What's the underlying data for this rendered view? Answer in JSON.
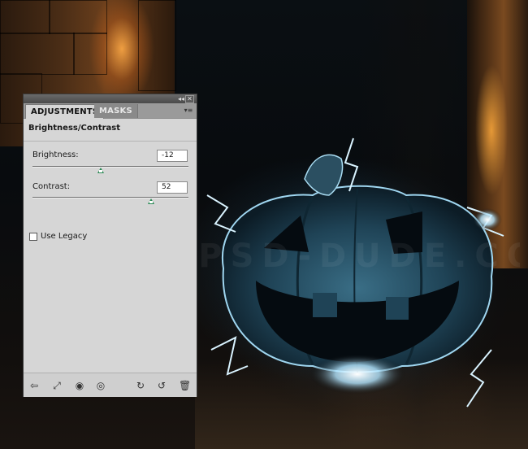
{
  "panel": {
    "tabs": [
      {
        "label": "ADJUSTMENTS",
        "active": true
      },
      {
        "label": "MASKS",
        "active": false
      }
    ],
    "collapse_glyph": "◂◂",
    "close_glyph": "✕",
    "menu_glyph": "▾≡",
    "heading": "Brightness/Contrast",
    "brightness": {
      "label": "Brightness:",
      "value": "-12",
      "slider_fraction": 0.44
    },
    "contrast": {
      "label": "Contrast:",
      "value": "52",
      "slider_fraction": 0.76
    },
    "use_legacy": {
      "label": "Use Legacy",
      "checked": false
    },
    "toolbar_icons": [
      {
        "name": "return-arrow-icon",
        "glyph": "⇦"
      },
      {
        "name": "expand-view-icon",
        "glyph": "⤢"
      },
      {
        "name": "clip-layer-icon",
        "glyph": "◉"
      },
      {
        "name": "visibility-eye-icon",
        "glyph": "◎"
      },
      {
        "name": "view-previous-icon",
        "glyph": "↻"
      },
      {
        "name": "reset-icon",
        "glyph": "↺"
      },
      {
        "name": "trash-icon",
        "glyph": "🗑"
      }
    ]
  },
  "canvas": {
    "watermark": "WWW.PSD-DUDE.COM"
  },
  "colors": {
    "panel_bg": "#d6d6d6",
    "slider_thumb": "#2a8a55",
    "glow": "#bfe8ff"
  }
}
